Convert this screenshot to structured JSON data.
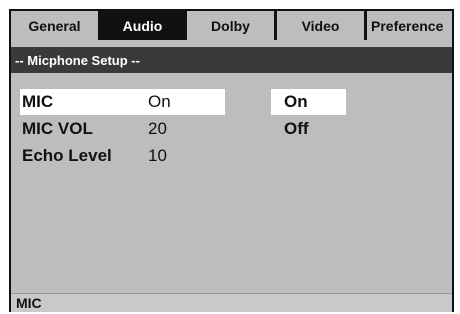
{
  "tabs": [
    {
      "label": "General",
      "active": false
    },
    {
      "label": "Audio",
      "active": true
    },
    {
      "label": "Dolby",
      "active": false
    },
    {
      "label": "Video",
      "active": false
    },
    {
      "label": "Preference",
      "active": false
    }
  ],
  "section": {
    "title": "-- Micphone Setup --"
  },
  "settings": [
    {
      "label": "MIC",
      "value": "On",
      "selected": true
    },
    {
      "label": "MIC VOL",
      "value": "20",
      "selected": false
    },
    {
      "label": "Echo Level",
      "value": "10",
      "selected": false
    }
  ],
  "options": [
    {
      "label": "On",
      "selected": true
    },
    {
      "label": "Off",
      "selected": false
    }
  ],
  "status_bar": {
    "text": "MIC"
  },
  "colors": {
    "background": "#bdbdbd",
    "tab_active": "#111111",
    "header": "#3a3a3a",
    "highlight": "#ffffff"
  }
}
